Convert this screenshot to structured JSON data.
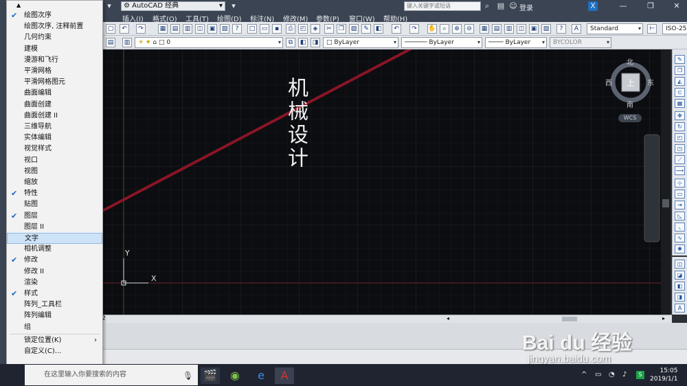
{
  "titlebar": {
    "workspace": "AutoCAD 经典",
    "menus": [
      "插入(I)",
      "格式(O)",
      "工具(T)",
      "绘图(D)",
      "标注(N)",
      "修改(M)",
      "参数(P)",
      "窗口(W)",
      "帮助(H)"
    ],
    "search_placeholder": "键入关键字或短语",
    "login_label": "登录"
  },
  "toolbar": {
    "text_style": "Standard",
    "dim_style": "ISO-25",
    "layer_name": "0",
    "color": "ByLayer",
    "linetype": "ByLayer",
    "lineweight": "ByLayer",
    "plotstyle": "BYCOLOR"
  },
  "canvas": {
    "drawing_text": "机械设计",
    "compass": {
      "north": "北",
      "south": "南",
      "east": "东",
      "west": "西",
      "top": "上"
    },
    "wcs_label": "WCS",
    "ucs_x": "X",
    "ucs_y": "Y",
    "tab_label": "2"
  },
  "context_menu": {
    "items": [
      {
        "label": "绘图次序",
        "checked": true
      },
      {
        "label": "绘图次序, 注释前置",
        "checked": false
      },
      {
        "label": "几何约束",
        "checked": false
      },
      {
        "label": "建模",
        "checked": false
      },
      {
        "label": "漫游和飞行",
        "checked": false
      },
      {
        "label": "平滑网格",
        "checked": false
      },
      {
        "label": "平滑网格图元",
        "checked": false
      },
      {
        "label": "曲面编辑",
        "checked": false
      },
      {
        "label": "曲面创建",
        "checked": false
      },
      {
        "label": "曲面创建 II",
        "checked": false
      },
      {
        "label": "三维导航",
        "checked": false
      },
      {
        "label": "实体编辑",
        "checked": false
      },
      {
        "label": "视觉样式",
        "checked": false
      },
      {
        "label": "视口",
        "checked": false
      },
      {
        "label": "视图",
        "checked": false
      },
      {
        "label": "缩放",
        "checked": false
      },
      {
        "label": "特性",
        "checked": true
      },
      {
        "label": "贴图",
        "checked": false
      },
      {
        "label": "图层",
        "checked": true
      },
      {
        "label": "图层 II",
        "checked": false
      },
      {
        "label": "文字",
        "checked": false,
        "highlighted": true
      },
      {
        "label": "相机调整",
        "checked": false
      },
      {
        "label": "修改",
        "checked": true
      },
      {
        "label": "修改 II",
        "checked": false
      },
      {
        "label": "渲染",
        "checked": false
      },
      {
        "label": "样式",
        "checked": true
      },
      {
        "label": "阵列_工具栏",
        "checked": false
      },
      {
        "label": "阵列编辑",
        "checked": false
      },
      {
        "label": "组",
        "checked": false
      }
    ],
    "lock_label": "锁定位置(K)",
    "customize_label": "自定义(C)..."
  },
  "taskbar": {
    "search_text": "在这里输入你要搜索的内容",
    "time": "15:05",
    "date": "2019/1/1"
  },
  "watermark": {
    "logo": "Bai  du 经验",
    "url": "jingyan.baidu.com"
  },
  "colors": {
    "arrow": "#8a1526",
    "canvas_bg": "#0c0d10",
    "highlight": "#cde3f7",
    "checkmark": "#1a63c2"
  }
}
